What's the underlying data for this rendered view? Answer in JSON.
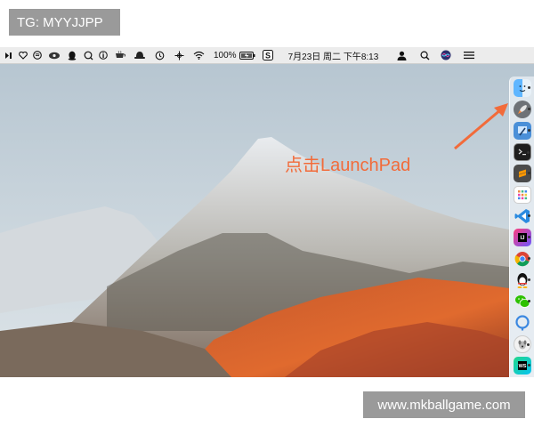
{
  "watermark_top": "TG: MYYJJPP",
  "watermark_bottom": "www.mkballgame.com",
  "annotation_text": "点击LaunchPad",
  "annotation_color": "#f26b3a",
  "menubar": {
    "battery_percent": "100%",
    "datetime": "7月23日 周二 下午8:13",
    "icons": [
      "play-pause-icon",
      "heart-icon",
      "spotify-icon",
      "eye-icon",
      "qq-icon",
      "find-icon",
      "info-icon",
      "coffee-cup-icon",
      "hat-icon",
      "time-machine-icon",
      "network-switch-icon",
      "wifi-icon",
      "battery-icon",
      "s-app-icon",
      "user-icon",
      "spotlight-icon",
      "siri-icon",
      "notification-center-icon"
    ]
  },
  "dock": {
    "apps": [
      "finder",
      "launchpad",
      "xcode",
      "terminal",
      "sublime-text",
      "calendar",
      "visual-studio-code",
      "intellij-idea",
      "chrome",
      "qq",
      "wechat",
      "sourcetree",
      "fetch",
      "webstorm",
      "safari"
    ]
  }
}
